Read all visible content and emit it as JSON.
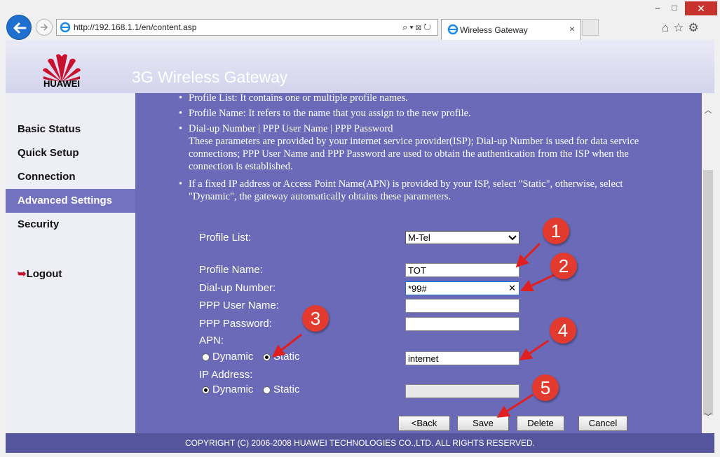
{
  "browser": {
    "url": "http://192.168.1.1/en/content.asp",
    "tab_title": "Wireless Gateway",
    "tab_close": "×",
    "minimize": "–",
    "maximize": "□",
    "close": "✕",
    "toolbar_icons": "⌂☆⚙",
    "address_tools": "⌕▾⊠↻"
  },
  "header": {
    "brand": "HUAWEI",
    "title": "3G Wireless Gateway"
  },
  "sidebar": {
    "items": [
      {
        "label": "Basic Status"
      },
      {
        "label": "Quick Setup"
      },
      {
        "label": "Connection"
      },
      {
        "label": "Advanced Settings"
      },
      {
        "label": "Security"
      }
    ],
    "logout": "Logout"
  },
  "info": {
    "profile_list": "Profile List: It contains one or multiple profile names.",
    "profile_name": "Profile Name: It refers to the name that you assign to the new profile.",
    "dialup_title": "Dial-up Number | PPP User Name | PPP Password",
    "dialup_desc": "These parameters are provided by your internet service provider(ISP); Dial-up Number is used for data service connections; PPP User Name and PPP Password are used to obtain the authentication from the ISP when the connection is established.",
    "fixed_ip": "If a fixed IP address or Access Point Name(APN) is provided by your ISP, select \"Static\", otherwise, select \"Dynamic\", the gateway automatically obtains these parameters."
  },
  "form": {
    "profile_list_label": "Profile List:",
    "profile_list_value": "M-Tel",
    "profile_name_label": "Profile Name:",
    "profile_name_value": "TOT",
    "dialup_label": "Dial-up Number:",
    "dialup_value": "*99#",
    "ppp_user_label": "PPP User Name:",
    "ppp_user_value": "",
    "ppp_password_label": "PPP Password:",
    "ppp_password_value": "",
    "apn_label": "APN:",
    "apn_value": "internet",
    "ip_label": "IP Address:",
    "ip_value": "",
    "dynamic": "Dynamic",
    "static": "Static",
    "apn_mode": "Static",
    "ip_mode": "Dynamic"
  },
  "buttons": {
    "back": "<Back",
    "save": "Save",
    "delete": "Delete",
    "cancel": "Cancel"
  },
  "footer": "COPYRIGHT (C) 2006-2008 HUAWEI TECHNOLOGIES CO.,LTD. ALL RIGHTS RESERVED.",
  "callouts": [
    "1",
    "2",
    "3",
    "4",
    "5"
  ],
  "colors": {
    "page_bg": "#7272c0",
    "callout": "#e23a2e",
    "brand_red": "#c8102e"
  }
}
